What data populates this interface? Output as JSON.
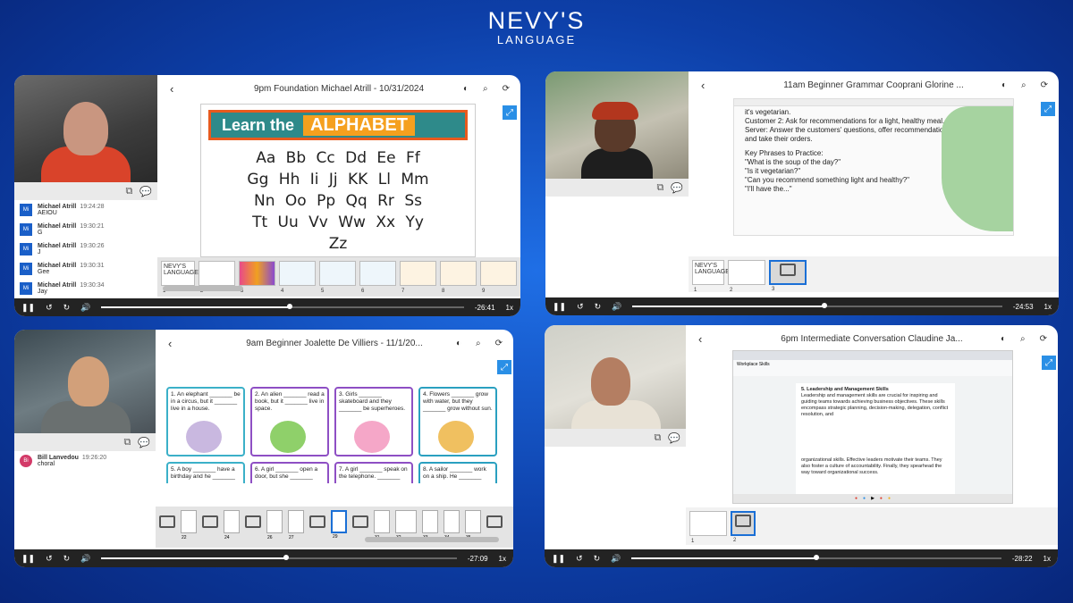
{
  "brand": {
    "name": "NEVY'S",
    "sub": "LANGUAGE"
  },
  "panels": [
    {
      "title": "9pm Foundation Michael Atrill - 10/31/2024",
      "chat": [
        {
          "initials": "Mi",
          "name": "Michael Atrill",
          "time": "19:24:28",
          "text": "AEIOU"
        },
        {
          "initials": "Mi",
          "name": "Michael Atrill",
          "time": "19:30:21",
          "text": "G"
        },
        {
          "initials": "Mi",
          "name": "Michael Atrill",
          "time": "19:30:26",
          "text": "J"
        },
        {
          "initials": "Mi",
          "name": "Michael Atrill",
          "time": "19:30:31",
          "text": "Gee"
        },
        {
          "initials": "Mi",
          "name": "Michael Atrill",
          "time": "19:30:34",
          "text": "Jay"
        }
      ],
      "slide": {
        "heading_a": "Learn the",
        "heading_b": "ALPHABET",
        "rows": [
          "Aa Bb Cc Dd Ee Ff",
          "Gg Hh Ii Jj KK Ll Mm",
          "Nn Oo Pp Qq Rr Ss",
          "Tt Uu Vv Ww Xx Yy",
          "Zz"
        ]
      },
      "thumbs": [
        {
          "num": "1",
          "label": "NEVY'S LANGUAGE"
        },
        {
          "num": "2",
          "label": ""
        },
        {
          "num": "3",
          "label": ""
        },
        {
          "num": "4",
          "label": ""
        },
        {
          "num": "5",
          "label": ""
        },
        {
          "num": "6",
          "label": ""
        },
        {
          "num": "7",
          "label": ""
        },
        {
          "num": "8",
          "label": ""
        },
        {
          "num": "9",
          "label": ""
        }
      ],
      "player": {
        "time": "-26:41",
        "speed": "1x",
        "progress": 0.52
      }
    },
    {
      "title": "11am Beginner Grammar Cooprani Glorine ...",
      "doc_lines": [
        "it's vegetarian.",
        "Customer 2: Ask for recommendations for a light, healthy meal.",
        "Server: Answer the customers' questions, offer recommendations,",
        "and take their orders.",
        "",
        "Key Phrases to Practice:",
        "\"What is the soup of the day?\"",
        "\"Is it vegetarian?\"",
        "\"Can you recommend something light and healthy?\"",
        "\"I'll have the...\""
      ],
      "thumbs": [
        {
          "num": "1",
          "label": "NEVY'S LANGUAGE"
        },
        {
          "num": "2",
          "label": ""
        },
        {
          "num": "3",
          "label": ""
        }
      ],
      "player": {
        "time": "-24:53",
        "speed": "1x",
        "progress": 0.52
      }
    },
    {
      "title": "9am Beginner Joalette De Villiers - 11/1/20...",
      "chat": [
        {
          "initials": "Bi",
          "name": "Bill Lanvedou",
          "time": "19:26:20",
          "text": "choral"
        }
      ],
      "cards": [
        {
          "text": "1. An elephant _______ be in a circus, but it _______ live in a house."
        },
        {
          "text": "2. An alien _______ read a book, but it _______ live in space."
        },
        {
          "text": "3. Girls _______ skateboard and they _______ be superheroes."
        },
        {
          "text": "4. Flowers _______ grow with water, but they _______ grow without sun."
        },
        {
          "text": "5. A boy _______ have a birthday and he _______"
        },
        {
          "text": "6. A girl _______ open a door, but she _______"
        },
        {
          "text": "7. A girl _______ speak on the telephone. _______"
        },
        {
          "text": "8. A sailor _______ work on a ship. He _______"
        }
      ],
      "thumb_nums": [
        "21",
        "22",
        "23",
        "24",
        "25",
        "26",
        "27",
        "28",
        "29",
        "30",
        "31",
        "32",
        "33",
        "34",
        "35",
        "36",
        "37"
      ],
      "player": {
        "time": "-27:09",
        "speed": "1x",
        "progress": 0.52
      }
    },
    {
      "title": "6pm Intermediate Conversation Claudine Ja...",
      "doc": {
        "doc_title": "Workplace Skills",
        "heading": "5. Leadership and Management Skills",
        "para1": "Leadership and management skills are crucial for inspiring and guiding teams towards achieving business objectives. These skills encompass strategic planning, decision-making, delegation, conflict resolution, and",
        "para2": "organizational skills. Effective leaders motivate their teams. They also foster a culture of accountability. Finally, they spearhead the way toward organizational success."
      },
      "thumbs": [
        {
          "num": "1",
          "label": ""
        },
        {
          "num": "2",
          "label": ""
        }
      ],
      "player": {
        "time": "-28:22",
        "speed": "1x",
        "progress": 0.5
      }
    }
  ],
  "colors": {
    "accent": "#1a6fd6",
    "player_bg": "#232323",
    "bg": "#0d3fa8"
  }
}
